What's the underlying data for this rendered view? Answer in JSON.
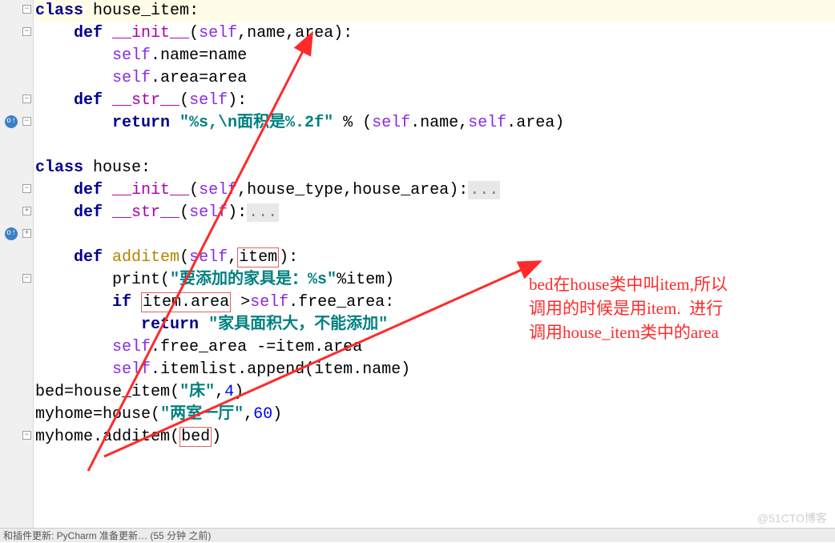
{
  "code": {
    "l1": {
      "kw": "class",
      "name": "house_item",
      "colon": ":"
    },
    "l2": {
      "kw": "def",
      "fn": "__init__",
      "open": "(",
      "self": "self",
      "comma1": ",",
      "p1": "name",
      "comma2": ",",
      "p2": "area",
      "close": "):"
    },
    "l3": {
      "self": "self",
      "dot": ".",
      "attr": "name",
      "eq": "=",
      "val": "name"
    },
    "l4": {
      "self": "self",
      "dot": ".",
      "attr": "area",
      "eq": "=",
      "val": "area"
    },
    "l5": {
      "kw": "def",
      "fn": "__str__",
      "open": "(",
      "self": "self",
      "close": "):"
    },
    "l6": {
      "kw": "return",
      "str": "\"%s,\\n面积是%.2f\"",
      "pct": " % (",
      "self1": "self",
      "dot1": ".",
      "a1": "name",
      "comma": ",",
      "self2": "self",
      "dot2": ".",
      "a2": "area",
      "end": ")"
    },
    "l8": {
      "kw": "class",
      "name": "house",
      "colon": ":"
    },
    "l9": {
      "kw": "def",
      "fn": "__init__",
      "open": "(",
      "self": "self",
      "comma1": ",",
      "p1": "house_type",
      "comma2": ",",
      "p2": "house_area",
      "close": "):",
      "folded": "..."
    },
    "l10": {
      "kw": "def",
      "fn": "__str__",
      "open": "(",
      "self": "self",
      "close": "):",
      "folded": "..."
    },
    "l12": {
      "kw": "def",
      "fn": "additem",
      "open": "(",
      "self": "self",
      "comma": ",",
      "p": "item",
      "close": "):"
    },
    "l13": {
      "call": "print",
      "open": "(",
      "str": "\"要添加的家具是：%s\"",
      "pct": "%",
      "var": "item",
      "close": ")"
    },
    "l14": {
      "kw": "if",
      "left": "item.area",
      "cmp": " >",
      "self": "self",
      "dot": ".",
      "attr": "free_area",
      "colon": ":"
    },
    "l15": {
      "kw": "return",
      "str": "\"家具面积大，不能添加\""
    },
    "l16": {
      "self": "self",
      "dot": ".",
      "attr": "free_area",
      "op": " -=",
      "var": "item",
      "dot2": ".",
      "attr2": "area"
    },
    "l17": {
      "self": "self",
      "dot": ".",
      "attr": "itemlist",
      "dot2": ".",
      "meth": "append",
      "open": "(",
      "var": "item",
      "dot3": ".",
      "attr2": "name",
      "close": ")"
    },
    "l18": {
      "var": "bed",
      "eq": "=",
      "cls": "house_item",
      "open": "(",
      "str": "\"床\"",
      "comma": ",",
      "num": "4",
      "close": ")"
    },
    "l19": {
      "var": "myhome",
      "eq": "=",
      "cls": "house",
      "open": "(",
      "str": "\"两室一厅\"",
      "comma": ",",
      "num": "60",
      "close": ")"
    },
    "l20": {
      "var": "myhome",
      "dot": ".",
      "meth": "additem",
      "open": "(",
      "arg": "bed",
      "close": ")"
    }
  },
  "annotation": {
    "line1": "bed在house类中叫item,所以",
    "line2": "调用的时候是用item.  进行",
    "line3": "调用house_item类中的area"
  },
  "status_text": "和插件更新: PyCharm 准备更新… (55 分钟 之前)",
  "watermark": "@51CTO博客"
}
